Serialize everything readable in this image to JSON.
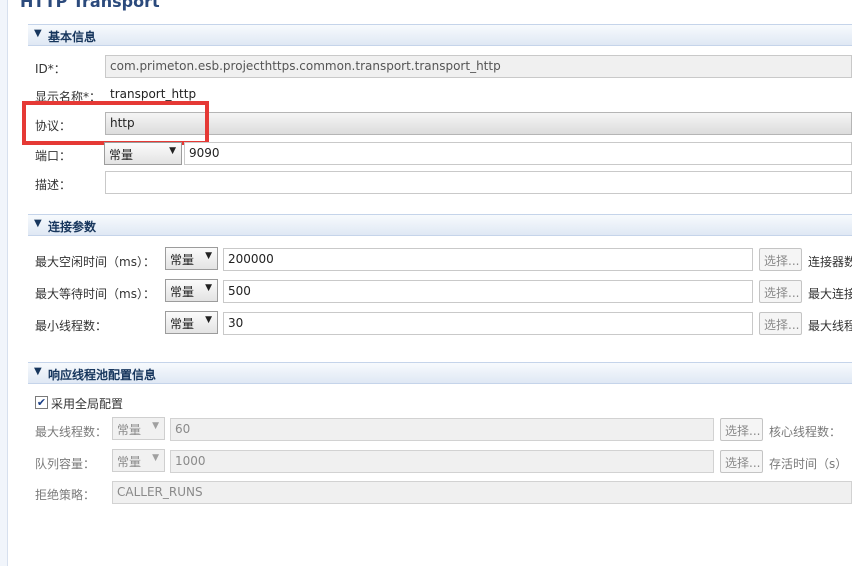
{
  "page_title": "HTTP Transport",
  "sections": {
    "basic": {
      "title": "基本信息"
    },
    "connection": {
      "title": "连接参数"
    },
    "pool": {
      "title": "响应线程池配置信息"
    }
  },
  "basic": {
    "id_label": "ID*：",
    "id_value": "com.primeton.esb.projecthttps.common.transport.transport_http",
    "display_label": "显示名称*：",
    "display_value": "transport_http",
    "protocol_label": "协议：",
    "protocol_value": "http",
    "port_label": "端口：",
    "port_type": "常量",
    "port_value": "9090",
    "desc_label": "描述：",
    "desc_value": ""
  },
  "connection": {
    "rows": [
      {
        "label": "最大空闲时间（ms）：",
        "type": "常量",
        "value": "200000",
        "button": "选择...",
        "right_label": "连接器数"
      },
      {
        "label": "最大等待时间（ms）：",
        "type": "常量",
        "value": "500",
        "button": "选择...",
        "right_label": "最大连接"
      },
      {
        "label": "最小线程数：",
        "type": "常量",
        "value": "30",
        "button": "选择...",
        "right_label": "最大线程"
      }
    ]
  },
  "pool": {
    "use_global_label": "采用全局配置",
    "use_global_checked": true,
    "rows": [
      {
        "label": "最大线程数：",
        "type": "常量",
        "value": "60",
        "button": "选择...",
        "right_label": "核心线程数："
      },
      {
        "label": "队列容量：",
        "type": "常量",
        "value": "1000",
        "button": "选择...",
        "right_label": "存活时间（s）"
      }
    ],
    "reject_label": "拒绝策略：",
    "reject_value": "CALLER_RUNS"
  },
  "icons": {
    "section_toggle": "triangle-down-icon",
    "dropdown": "chevron-down-icon",
    "check": "checkmark-icon"
  },
  "colors": {
    "highlight": "#e53935",
    "section_title": "#17365d"
  }
}
